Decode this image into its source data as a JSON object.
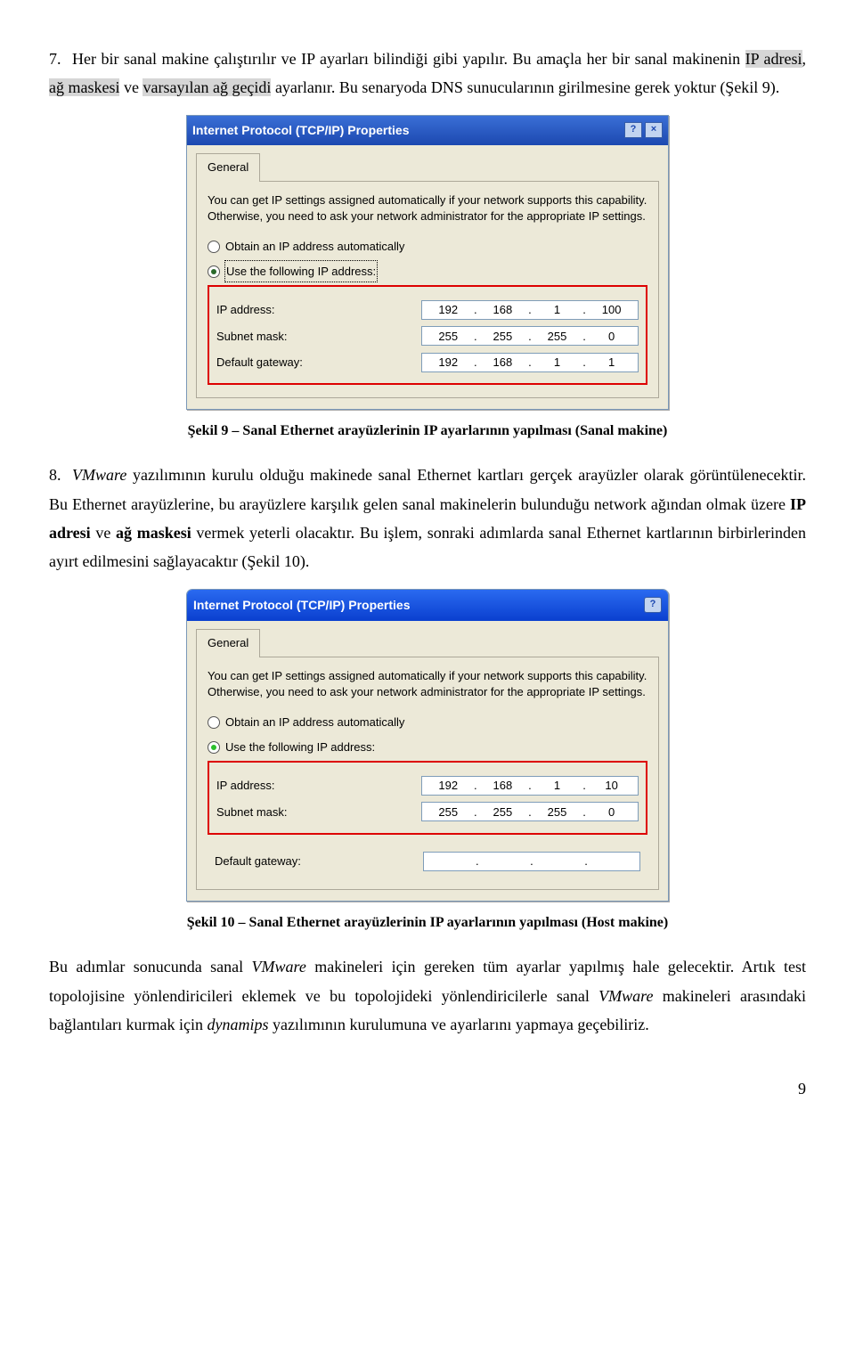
{
  "item7": {
    "num": "7.",
    "t1": "Her bir sanal makine çalıştırılır ve IP ayarları bilindiği gibi yapılır. Bu amaçla her bir sanal makinenin ",
    "h1": "IP adresi",
    "t2": ", ",
    "h2": "ağ maskesi",
    "t3": " ve ",
    "h3": "varsayılan ağ geçidi",
    "t4": " ayarlanır. Bu senaryoda DNS sunucularının girilmesine gerek yoktur (Şekil 9)."
  },
  "dlg1": {
    "title": "Internet Protocol (TCP/IP) Properties",
    "help_btn": "?",
    "close_btn": "×",
    "tab": "General",
    "desc": "You can get IP settings assigned automatically if your network supports this capability. Otherwise, you need to ask your network administrator for the appropriate IP settings.",
    "opt_auto": "Obtain an IP address automatically",
    "opt_manual": "Use the following IP address:",
    "lbl_ip": "IP address:",
    "lbl_mask": "Subnet mask:",
    "lbl_gw": "Default gateway:",
    "ip": [
      "192",
      "168",
      "1",
      "100"
    ],
    "mask": [
      "255",
      "255",
      "255",
      "0"
    ],
    "gw": [
      "192",
      "168",
      "1",
      "1"
    ]
  },
  "caption1": "Şekil 9 – Sanal Ethernet arayüzlerinin IP ayarlarının yapılması (Sanal makine)",
  "item8": {
    "num": "8.",
    "t1a": "VMware",
    "t1b": " yazılımının kurulu olduğu makinede sanal Ethernet kartları gerçek arayüzler olarak görüntülenecektir. Bu Ethernet arayüzlerine, bu arayüzlere karşılık gelen sanal makinelerin bulunduğu network ağından olmak üzere ",
    "b1": "IP adresi",
    "t2": " ve ",
    "b2": "ağ maskesi",
    "t3": " vermek yeterli olacaktır. Bu işlem, sonraki adımlarda sanal Ethernet kartlarının birbirlerinden ayırt edilmesini sağlayacaktır (Şekil 10)."
  },
  "dlg2": {
    "title": "Internet Protocol (TCP/IP) Properties",
    "help_btn": "?",
    "close_btn": "×",
    "tab": "General",
    "desc": "You can get IP settings assigned automatically if your network supports this capability. Otherwise, you need to ask your network administrator for the appropriate IP settings.",
    "opt_auto": "Obtain an IP address automatically",
    "opt_manual": "Use the following IP address:",
    "lbl_ip": "IP address:",
    "lbl_mask": "Subnet mask:",
    "lbl_gw": "Default gateway:",
    "ip": [
      "192",
      "168",
      "1",
      "10"
    ],
    "mask": [
      "255",
      "255",
      "255",
      "0"
    ],
    "gw": [
      "",
      "",
      "",
      ""
    ]
  },
  "caption2": "Şekil 10 – Sanal Ethernet arayüzlerinin IP ayarlarının yapılması (Host makine)",
  "closing": {
    "t1": "Bu adımlar sonucunda sanal ",
    "i1": "VMware",
    "t2": " makineleri için gereken tüm ayarlar yapılmış hale gelecektir. Artık test topolojisine yönlendiricileri eklemek ve bu topolojideki yönlendiricilerle sanal ",
    "i2": "VMware",
    "t3": " makineleri arasındaki bağlantıları kurmak için ",
    "i3": "dynamips",
    "t4": " yazılımının kurulumuna ve ayarlarını yapmaya geçebiliriz."
  },
  "pagenum": "9"
}
